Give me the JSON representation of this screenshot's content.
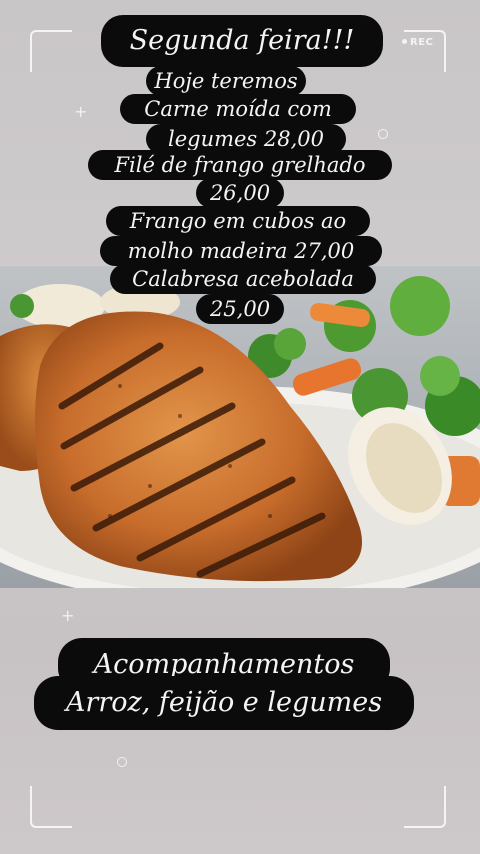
{
  "title": "Segunda feira!!!",
  "recording_indicator": "REC",
  "menu_lines": [
    "Hoje teremos",
    "Carne moída com",
    "legumes 28,00",
    "Filé de frango grelhado",
    "26,00",
    "Frango em cubos ao",
    "molho madeira 27,00",
    "Calabresa acebolada",
    "25,00"
  ],
  "sides": {
    "heading": "Acompanhamentos",
    "items": "Arroz, feijão e legumes"
  },
  "icons": [
    "viewfinder-corner-icon",
    "plus-icon",
    "ring-icon",
    "record-dot-icon"
  ],
  "colors": {
    "pill_background": "#0b0b0b",
    "text": "#f4f4f4",
    "background": "#cbc8ca"
  }
}
